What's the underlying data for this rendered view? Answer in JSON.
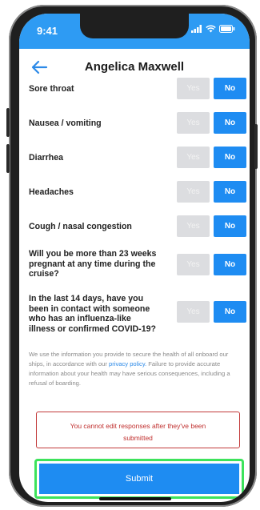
{
  "status_bar": {
    "time": "9:41"
  },
  "header": {
    "title": "Angelica Maxwell"
  },
  "questions": [
    {
      "text": "Sore throat",
      "yes": "Yes",
      "no": "No",
      "selected": "No"
    },
    {
      "text": "Nausea / vomiting",
      "yes": "Yes",
      "no": "No",
      "selected": "No"
    },
    {
      "text": "Diarrhea",
      "yes": "Yes",
      "no": "No",
      "selected": "No"
    },
    {
      "text": "Headaches",
      "yes": "Yes",
      "no": "No",
      "selected": "No"
    },
    {
      "text": "Cough / nasal congestion",
      "yes": "Yes",
      "no": "No",
      "selected": "No"
    },
    {
      "text": "Will you be more than 23 weeks pregnant at any time during the cruise?",
      "yes": "Yes",
      "no": "No",
      "selected": "No"
    },
    {
      "text": "In the last 14 days, have you been in contact with someone who has an influenza-like illness or confirmed COVID-19?",
      "yes": "Yes",
      "no": "No",
      "selected": "No"
    }
  ],
  "info": {
    "before_link": "We use the information you provide to secure the health of all onboard our ships, in accordance with our ",
    "link": "privacy policy.",
    "after_link": " Failure to provide accurate information about your health may have serious consequences, including a refusal of boarding."
  },
  "warning": "You cannot edit responses after they've been submitted",
  "submit_label": "Submit",
  "colors": {
    "primary": "#1e8cf2",
    "warning": "#c0302f",
    "highlight": "#3de35c"
  }
}
